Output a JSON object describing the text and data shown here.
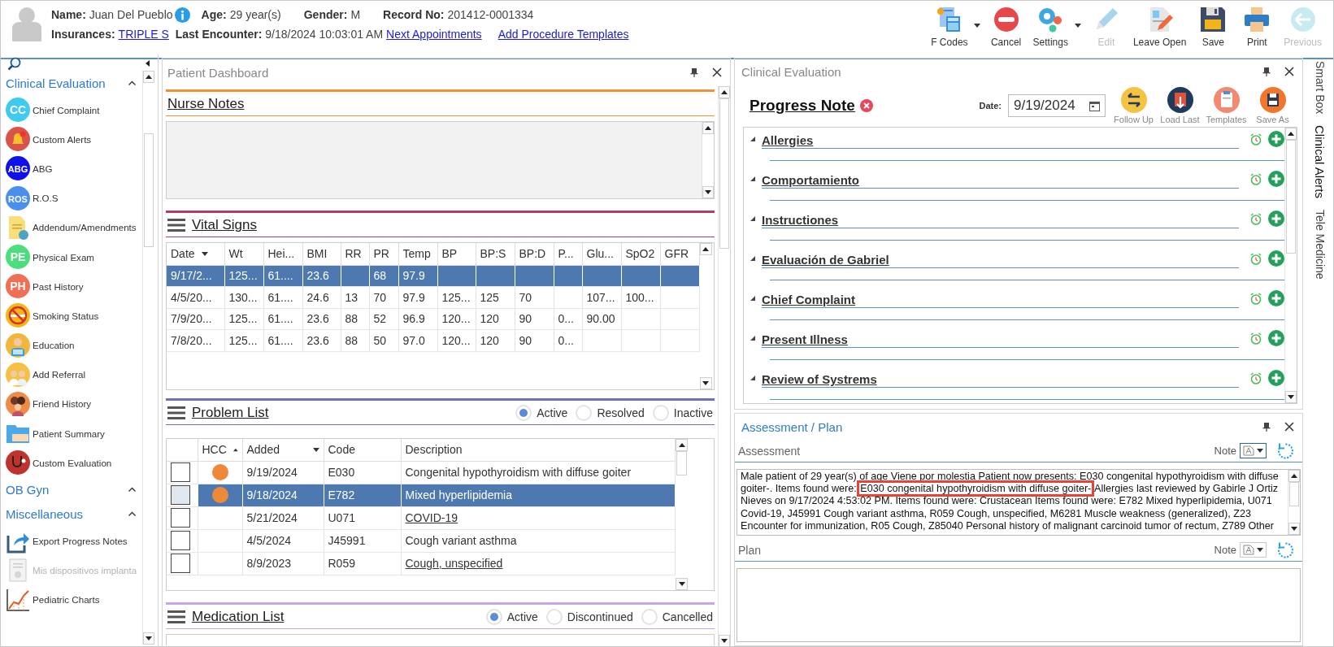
{
  "patient": {
    "name_label": "Name:",
    "name": "Juan Del Pueblo",
    "age_label": "Age:",
    "age": "29 year(s)",
    "gender_label": "Gender:",
    "gender": "M",
    "record_label": "Record No:",
    "record": "201412-0001334",
    "insurances_label": "Insurances:",
    "insurance": "TRIPLE S",
    "last_encounter_label": "Last Encounter:",
    "last_encounter": "9/18/2024 10:03:01 AM",
    "links": [
      "Next Appointments",
      "Add Procedure Templates"
    ]
  },
  "toolbar": [
    {
      "label": "F Codes",
      "kind": "fcodes",
      "dropdown": true,
      "disabled": false
    },
    {
      "label": "Cancel",
      "kind": "cancel",
      "dropdown": false,
      "disabled": false
    },
    {
      "label": "Settings",
      "kind": "settings",
      "dropdown": true,
      "disabled": false
    },
    {
      "label": "Edit",
      "kind": "edit",
      "dropdown": false,
      "disabled": true
    },
    {
      "label": "Leave Open",
      "kind": "leave_open",
      "dropdown": false,
      "disabled": false
    },
    {
      "label": "Save",
      "kind": "save",
      "dropdown": false,
      "disabled": false
    },
    {
      "label": "Print",
      "kind": "print",
      "dropdown": false,
      "disabled": false
    },
    {
      "label": "Previous",
      "kind": "previous",
      "dropdown": false,
      "disabled": true
    }
  ],
  "sidebar": {
    "sections": [
      {
        "title": "Clinical Evaluation",
        "expanded": true,
        "items": [
          {
            "label": "Chief Complaint",
            "kind": "badge",
            "badge": "CC",
            "color": "#3fcbee",
            "disabled": false
          },
          {
            "label": "Custom Alerts",
            "kind": "bell",
            "disabled": false
          },
          {
            "label": "ABG",
            "kind": "badge",
            "badge": "ABG",
            "color": "#1010e8",
            "disabled": false
          },
          {
            "label": "R.O.S",
            "kind": "badge",
            "badge": "ROS",
            "color": "#4a8ef0",
            "disabled": false
          },
          {
            "label": "Addendum/Amendments",
            "kind": "document",
            "disabled": false
          },
          {
            "label": "Physical Exam",
            "kind": "badge",
            "badge": "PE",
            "color": "#4bde7c",
            "disabled": false
          },
          {
            "label": "Past History",
            "kind": "badge",
            "badge": "PH",
            "color": "#f26f55",
            "disabled": false
          },
          {
            "label": "Smoking Status",
            "kind": "smoking",
            "disabled": false
          },
          {
            "label": "Education",
            "kind": "person",
            "disabled": false
          },
          {
            "label": "Add Referral",
            "kind": "people",
            "disabled": false
          },
          {
            "label": "Friend History",
            "kind": "family",
            "disabled": false
          },
          {
            "label": "Patient Summary",
            "kind": "folder",
            "disabled": false
          },
          {
            "label": "Custom Evaluation",
            "kind": "stethoscope",
            "disabled": false
          }
        ]
      },
      {
        "title": "OB Gyn",
        "expanded": true
      },
      {
        "title": "Miscellaneous",
        "expanded": true,
        "items": [
          {
            "label": "Export Progress Notes",
            "kind": "export",
            "disabled": false
          },
          {
            "label": "Mis dispositivos implanta",
            "kind": "certificate",
            "disabled": true
          },
          {
            "label": "Pediatric Charts",
            "kind": "chart",
            "disabled": false
          }
        ]
      }
    ]
  },
  "dashboard": {
    "title": "Patient Dashboard",
    "nurse_notes": {
      "title": "Nurse Notes"
    },
    "vital_signs": {
      "title": "Vital Signs",
      "columns": [
        "Date",
        "Wt",
        "Hei...",
        "BMI",
        "RR",
        "PR",
        "Temp",
        "BP",
        "BP:S",
        "BP:D",
        "P...",
        "Glu...",
        "SpO2",
        "GFR"
      ],
      "rows": [
        {
          "selected": true,
          "cells": [
            "9/17/2...",
            "125...",
            "61....",
            "23.6",
            "",
            "68",
            "97.9",
            "",
            "",
            "",
            "",
            "",
            "",
            ""
          ]
        },
        {
          "selected": false,
          "cells": [
            "4/5/20...",
            "130...",
            "61....",
            "24.6",
            "13",
            "70",
            "97.9",
            "125...",
            "125",
            "70",
            "",
            "107...",
            "100...",
            ""
          ]
        },
        {
          "selected": false,
          "cells": [
            "7/9/20...",
            "125...",
            "61....",
            "23.6",
            "88",
            "52",
            "96.9",
            "120...",
            "120",
            "90",
            "0...",
            "90.00",
            "",
            ""
          ]
        },
        {
          "selected": false,
          "cells": [
            "7/8/20...",
            "125...",
            "61....",
            "23.6",
            "88",
            "50",
            "97.0",
            "120...",
            "120",
            "90",
            "0...",
            "",
            "",
            ""
          ]
        }
      ]
    },
    "problem_list": {
      "title": "Problem List",
      "filters": [
        {
          "label": "Active",
          "selected": true
        },
        {
          "label": "Resolved",
          "selected": false
        },
        {
          "label": "Inactive",
          "selected": false
        }
      ],
      "columns": [
        "HCC",
        "Added",
        "Code",
        "Description"
      ],
      "rows": [
        {
          "selected": false,
          "checked": false,
          "hcc": true,
          "added": "9/19/2024",
          "code": "E030",
          "description": "Congenital hypothyroidism with diffuse goiter",
          "link": false
        },
        {
          "selected": true,
          "checked": false,
          "hcc": true,
          "added": "9/18/2024",
          "code": "E782",
          "description": "Mixed hyperlipidemia",
          "link": false
        },
        {
          "selected": false,
          "checked": false,
          "hcc": false,
          "added": "5/21/2024",
          "code": "U071",
          "description": "COVID-19",
          "link": true
        },
        {
          "selected": false,
          "checked": false,
          "hcc": false,
          "added": "4/5/2024",
          "code": "J45991",
          "description": "Cough variant asthma",
          "link": false
        },
        {
          "selected": false,
          "checked": false,
          "hcc": false,
          "added": "8/9/2023",
          "code": "R059",
          "description": "Cough, unspecified",
          "link": true
        }
      ]
    },
    "medication_list": {
      "title": "Medication List",
      "filters": [
        {
          "label": "Active",
          "selected": true
        },
        {
          "label": "Discontinued",
          "selected": false
        },
        {
          "label": "Cancelled",
          "selected": false
        }
      ]
    }
  },
  "clinical": {
    "title": "Clinical Evaluation",
    "note_title": "Progress Note",
    "date_label": "Date:",
    "date": "9/19/2024",
    "actions": [
      {
        "label": "Follow Up",
        "kind": "follow_up"
      },
      {
        "label": "Load Last",
        "kind": "load_last"
      },
      {
        "label": "Templates",
        "kind": "templates"
      },
      {
        "label": "Save As",
        "kind": "save_as"
      }
    ],
    "sections": [
      "Allergies",
      "Comportamiento",
      "Instructiones",
      "Evaluación de Gabriel",
      "Chief Complaint",
      "Present Illness",
      "Review of Systrems"
    ]
  },
  "assessment_plan": {
    "title": "Assessment / Plan",
    "assessment_label": "Assessment",
    "note_label": "Note",
    "assessment_text": {
      "before": "Male patient of 29 year(s) of age Viene por molestia Patient now presents: E030 congenital hypothyroidism with diffuse goiter-. Items found were: ",
      "highlight": "E030 congenital hypothyroidism with diffuse goiter-",
      "after": "  Allergies last reviewed by Gabirle J Ortiz Nieves on 9/17/2024 4:53:02 PM.    Items found were:  Crustacean  Items found were:  E782 Mixed hyperlipidemia, U071 Covid-19, J45991 Cough variant asthma, R059 Cough, unspecified, M6281 Muscle weakness (generalized), Z23 Encounter for immunization, R05 Cough, Z85040 Personal history of malignant carcinoid tumor of rectum, Z789 Other"
    },
    "plan_label": "Plan",
    "plan_note_label": "Note"
  },
  "side_tabs": [
    {
      "label": "Smart Box",
      "selected": false
    },
    {
      "label": "Clinical Alerts",
      "selected": true
    },
    {
      "label": "Tele Medicine",
      "selected": false
    }
  ]
}
